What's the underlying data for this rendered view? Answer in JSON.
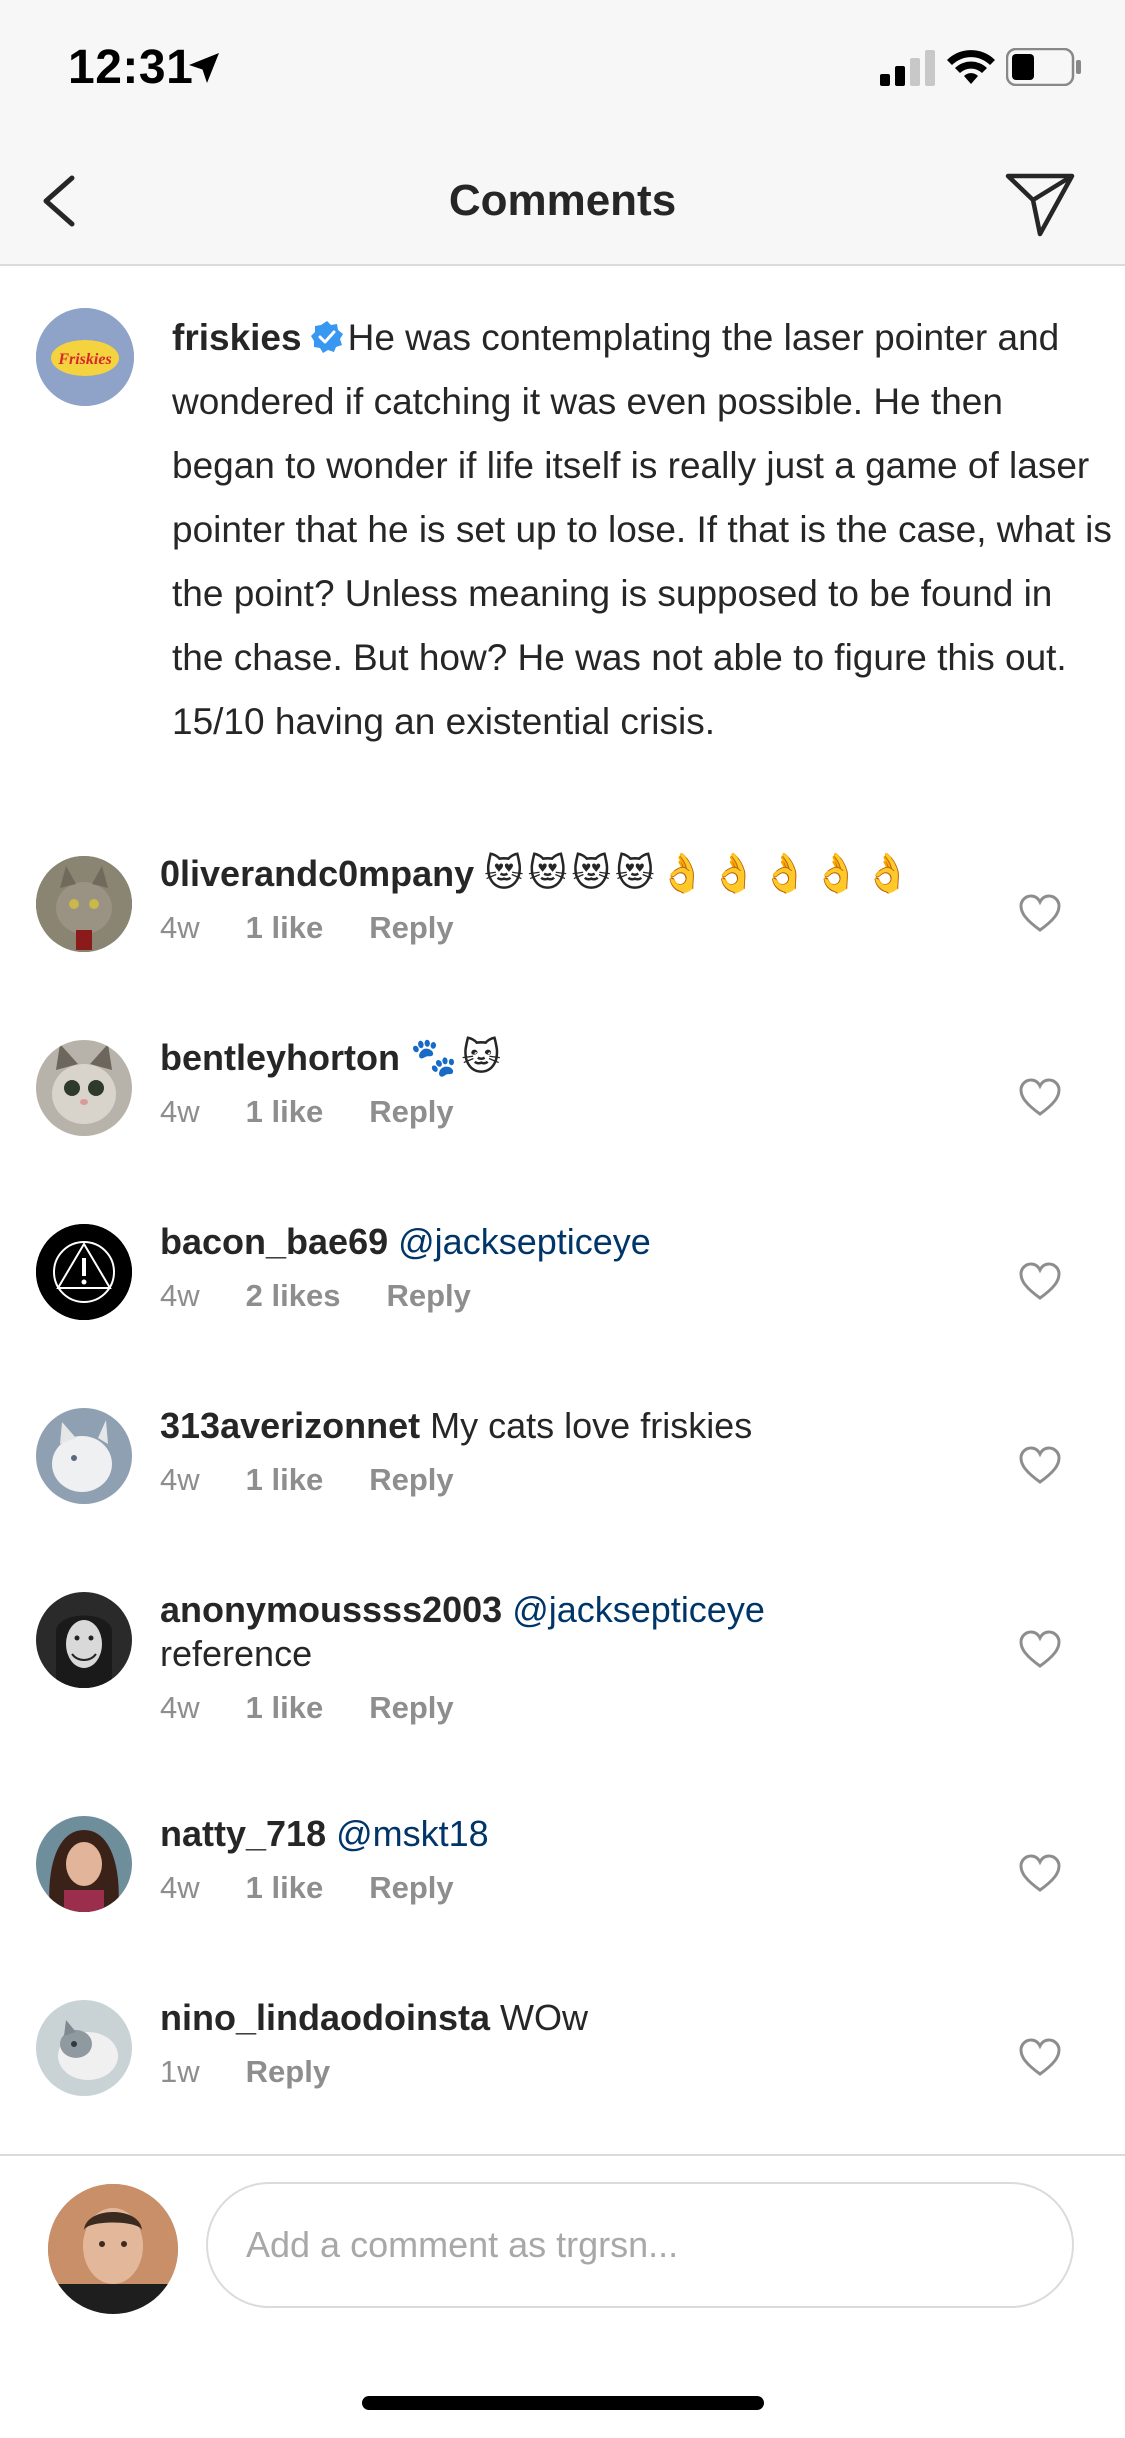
{
  "status_bar": {
    "time": "12:31"
  },
  "nav": {
    "title": "Comments"
  },
  "caption": {
    "username": "friskies",
    "logo_text": "Friskies",
    "text": "He was contemplating the laser pointer and wondered if catching it was even possible. He then began to wonder if life itself is really just a game of laser pointer that he is set up to lose. If that is the case, what is the point? Unless meaning is supposed to be found in the chase. But how? He was not able to figure this out. 15/10 having an existential crisis."
  },
  "comments": [
    {
      "username": "0liverandc0mpany",
      "text": "",
      "emoji": "😻😻😻😻👌👌👌👌👌",
      "mention": "",
      "age": "4w",
      "likes": "1 like",
      "reply": "Reply"
    },
    {
      "username": "bentleyhorton",
      "text": "",
      "emoji": "🐾🐱",
      "mention": "",
      "age": "4w",
      "likes": "1 like",
      "reply": "Reply"
    },
    {
      "username": "bacon_bae69",
      "text": "",
      "emoji": "",
      "mention": "@jacksepticeye",
      "age": "4w",
      "likes": "2 likes",
      "reply": "Reply"
    },
    {
      "username": "313averizonnet",
      "text": "My cats love friskies",
      "emoji": "",
      "mention": "",
      "age": "4w",
      "likes": "1 like",
      "reply": "Reply"
    },
    {
      "username": "anonymoussss2003",
      "text": "reference",
      "emoji": "",
      "mention": "@jacksepticeye",
      "age": "4w",
      "likes": "1 like",
      "reply": "Reply"
    },
    {
      "username": "natty_718",
      "text": "",
      "emoji": "",
      "mention": "@mskt18",
      "age": "4w",
      "likes": "1 like",
      "reply": "Reply"
    },
    {
      "username": "nino_lindaodoinsta",
      "text": "WOw",
      "emoji": "",
      "mention": "",
      "age": "1w",
      "likes": "",
      "reply": "Reply"
    }
  ],
  "composer": {
    "placeholder": "Add a comment as trgrsn..."
  },
  "colors": {
    "mention": "#003569",
    "meta": "#8e8e8e",
    "verified": "#3897f0",
    "logo_red": "#d8262c",
    "logo_yellow": "#f5d33f"
  }
}
